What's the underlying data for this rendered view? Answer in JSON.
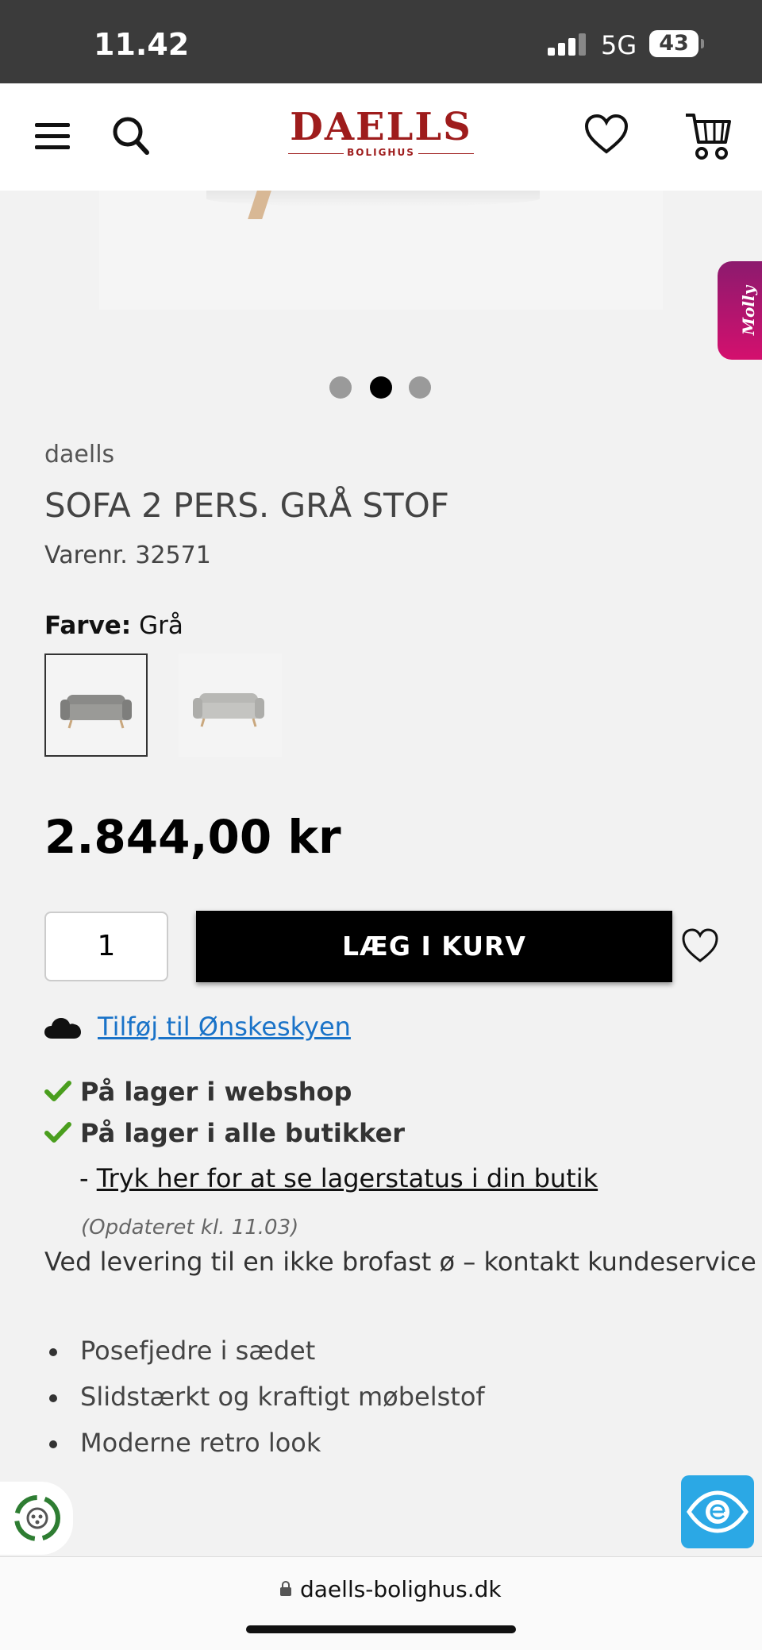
{
  "status_bar": {
    "time": "11.42",
    "network": "5G",
    "battery": "43"
  },
  "header": {
    "logo_text": "DAELLS",
    "logo_subtitle": "BOLIGHUS"
  },
  "chat_widget": {
    "label": "Molly"
  },
  "carousel": {
    "active_index": 1,
    "count": 3
  },
  "product": {
    "brand": "daells",
    "title": "SOFA 2 PERS. GRÅ STOF",
    "sku": "Varenr. 32571",
    "color_label": "Farve:",
    "color_value": "Grå",
    "price": "2.844,00 kr"
  },
  "purchase": {
    "quantity": "1",
    "add_to_cart": "LÆG I KURV",
    "wishlist_link": "Tilføj til Ønskeskyen"
  },
  "stock": {
    "webshop": "På lager i webshop",
    "stores": "På lager i alle butikker",
    "store_link_prefix": "-",
    "store_link": "Tryk her for at se lagerstatus i din butik",
    "updated": "(Opdateret kl. 11.03)",
    "delivery_note": "Ved levering til en ikke brofast ø – kontakt kundeservice"
  },
  "features": [
    "Posefjedre i sædet",
    "Slidstærkt og kraftigt møbelstof",
    "Moderne retro look"
  ],
  "browser": {
    "url": "daells-bolighus.dk"
  },
  "colors": {
    "brand_red": "#9e1c1c",
    "link_blue": "#1a73c8",
    "check_green": "#4a9e1e",
    "molly_pink": "#d4106e",
    "accessibility_blue": "#2ba8e5"
  }
}
